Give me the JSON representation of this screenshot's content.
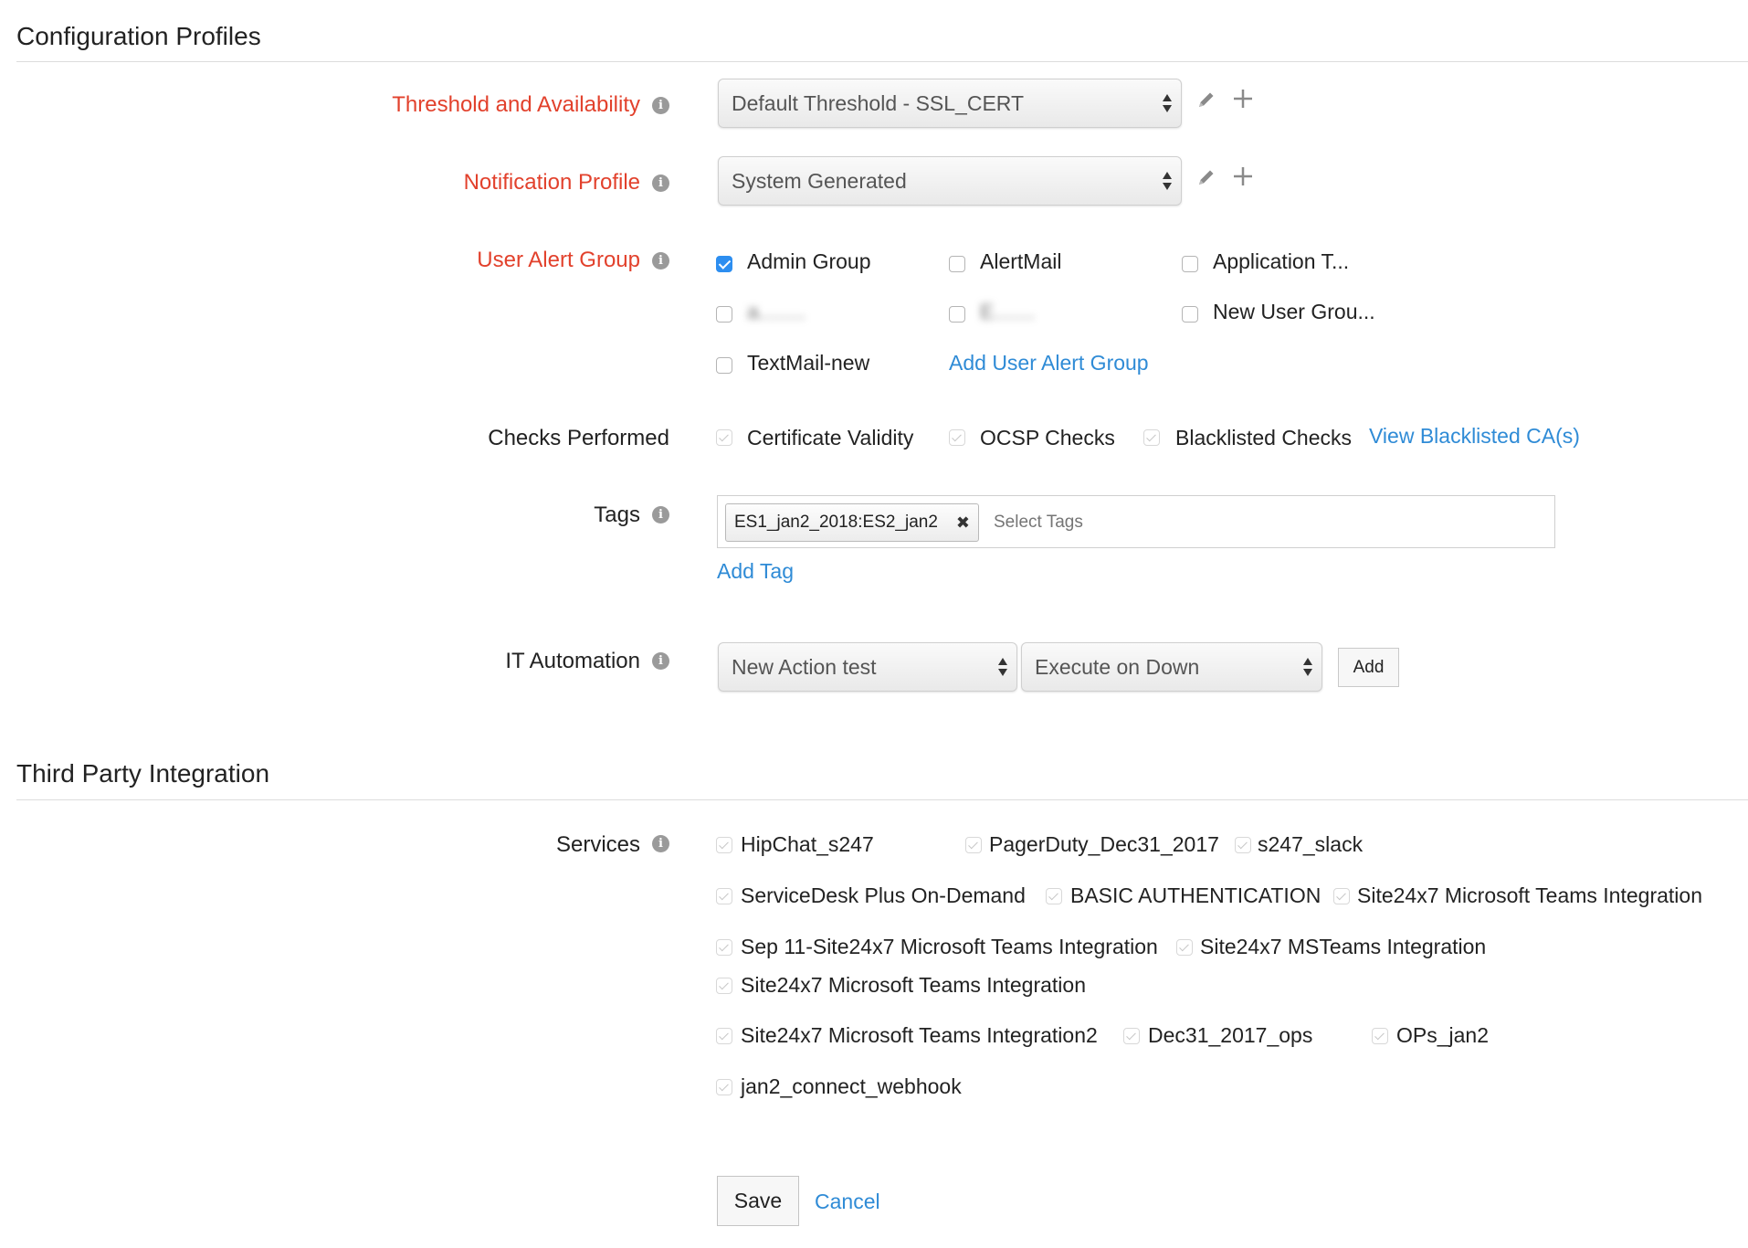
{
  "sections": {
    "config_title": "Configuration Profiles",
    "third_party_title": "Third Party Integration"
  },
  "threshold": {
    "label": "Threshold and Availability",
    "value": "Default Threshold - SSL_CERT"
  },
  "notification": {
    "label": "Notification Profile",
    "value": "System Generated"
  },
  "user_alert_group": {
    "label": "User Alert Group",
    "options": [
      {
        "label": "Admin Group",
        "checked": true
      },
      {
        "label": "AlertMail",
        "checked": false
      },
      {
        "label": "Application T...",
        "checked": false
      },
      {
        "label": "a........",
        "checked": false,
        "obscured": true
      },
      {
        "label": "E.......",
        "checked": false,
        "obscured": true
      },
      {
        "label": "New User Grou...",
        "checked": false
      },
      {
        "label": "TextMail-new",
        "checked": false
      }
    ],
    "add_link": "Add User Alert Group"
  },
  "checks": {
    "label": "Checks Performed",
    "options": [
      "Certificate Validity",
      "OCSP Checks",
      "Blacklisted Checks"
    ],
    "view_link": "View Blacklisted CA(s)"
  },
  "tags": {
    "label": "Tags",
    "chip": "ES1_jan2_2018:ES2_jan2",
    "placeholder": "Select Tags",
    "add_link": "Add Tag"
  },
  "it_automation": {
    "label": "IT Automation",
    "action": "New Action test",
    "trigger": "Execute on Down",
    "add_button": "Add"
  },
  "services": {
    "label": "Services",
    "items": [
      "HipChat_s247",
      "PagerDuty_Dec31_2017",
      "s247_slack",
      "ServiceDesk Plus On-Demand",
      "BASIC AUTHENTICATION",
      "Site24x7 Microsoft Teams Integration",
      "Sep 11-Site24x7 Microsoft Teams Integration",
      "Site24x7 MSTeams Integration",
      "Site24x7 Microsoft Teams Integration",
      "Site24x7 Microsoft Teams Integration2",
      "Dec31_2017_ops",
      "OPs_jan2",
      "jan2_connect_webhook"
    ]
  },
  "footer": {
    "save": "Save",
    "cancel": "Cancel"
  },
  "icons": {
    "info": "info-icon",
    "edit": "pencil-icon",
    "add": "plus-icon",
    "remove": "close-icon"
  },
  "colors": {
    "required_label": "#e2412c",
    "link": "#2f8bd6",
    "checkbox_checked": "#2d8ef0"
  }
}
